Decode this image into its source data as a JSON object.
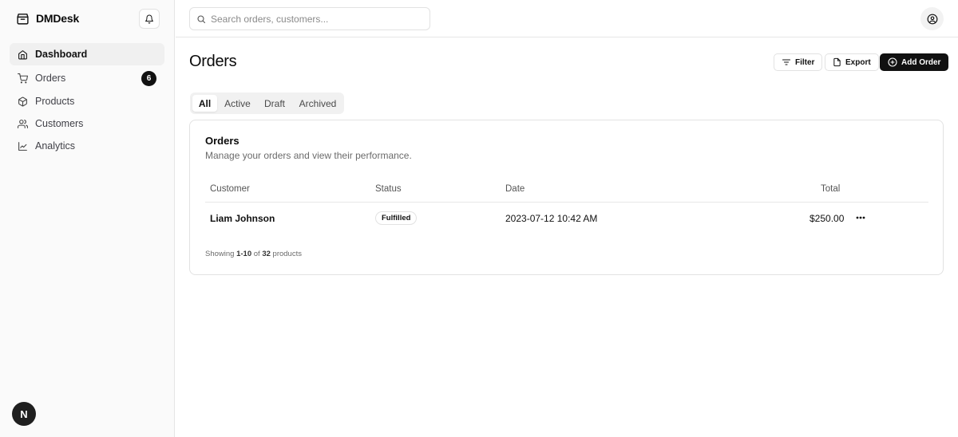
{
  "app": {
    "name": "DMDesk",
    "user_initial": "N"
  },
  "sidebar": {
    "items": [
      {
        "label": "Dashboard",
        "icon": "home-icon"
      },
      {
        "label": "Orders",
        "icon": "cart-icon",
        "badge": "6"
      },
      {
        "label": "Products",
        "icon": "package-icon"
      },
      {
        "label": "Customers",
        "icon": "users-icon"
      },
      {
        "label": "Analytics",
        "icon": "line-chart-icon"
      }
    ],
    "active_item": "Dashboard"
  },
  "topbar": {
    "search_placeholder": "Search orders, customers..."
  },
  "main": {
    "title": "Orders",
    "actions": {
      "filter": "Filter",
      "export": "Export",
      "add": "Add Order"
    },
    "tabs": [
      "All",
      "Active",
      "Draft",
      "Archived"
    ],
    "active_tab": "All"
  },
  "card": {
    "title": "Orders",
    "description": "Manage your orders and view their performance.",
    "columns": {
      "customer": "Customer",
      "status": "Status",
      "date": "Date",
      "total": "Total"
    },
    "rows": [
      {
        "customer": "Liam Johnson",
        "status": "Fulfilled",
        "date": "2023-07-12 10:42 AM",
        "total": "$250.00"
      }
    ],
    "footer": {
      "prefix": "Showing",
      "range": "1-10",
      "of": "of",
      "count": "32",
      "suffix": "products"
    }
  },
  "colors": {
    "primary": "#111111",
    "sidebar_bg": "#fafafa",
    "border": "#e2e2e2",
    "muted_text": "#6b6b6b"
  }
}
